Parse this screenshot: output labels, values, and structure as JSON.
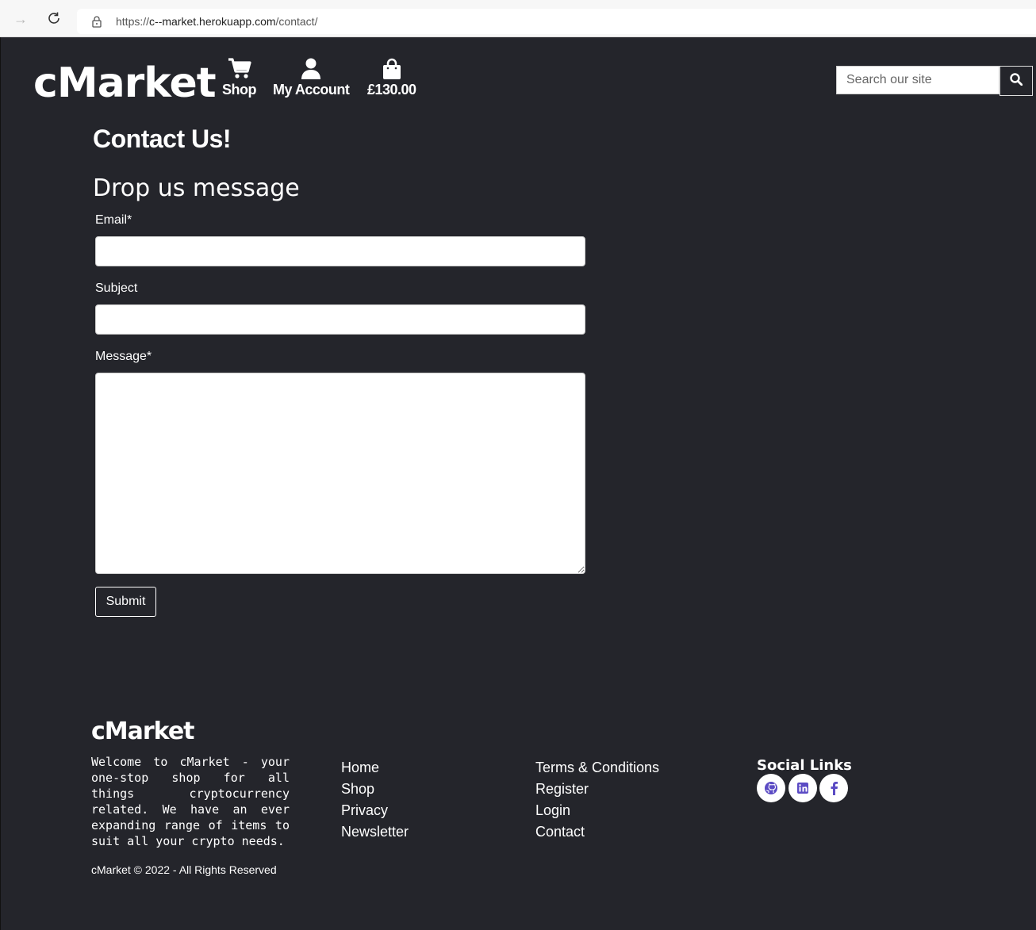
{
  "browser": {
    "url_scheme": "https://",
    "url_host": "c--market.herokuapp.com",
    "url_path": "/contact/"
  },
  "header": {
    "logo": "cMarket",
    "nav": [
      {
        "label": "Shop",
        "icon": "cart-icon"
      },
      {
        "label": "My Account",
        "icon": "user-icon"
      },
      {
        "label": "£130.00",
        "icon": "bag-icon"
      }
    ],
    "search_placeholder": "Search our site"
  },
  "main": {
    "title": "Contact Us!",
    "form_title": "Drop us message",
    "email_label": "Email*",
    "subject_label": "Subject",
    "message_label": "Message*",
    "submit_label": "Submit"
  },
  "footer": {
    "logo": "cMarket",
    "about": "Welcome to cMarket - your one-stop shop for all things cryptocurrency related. We have an ever expanding range of items to suit all your crypto needs.",
    "copyright": "cMarket © 2022 - All Rights Reserved",
    "links_col1": [
      "Home",
      "Shop",
      "Privacy",
      "Newsletter"
    ],
    "links_col2": [
      "Terms & Conditions",
      "Register",
      "Login",
      "Contact"
    ],
    "social_title": "Social Links",
    "social": [
      "github-icon",
      "linkedin-icon",
      "facebook-icon"
    ],
    "social_color": "#5b4bc4"
  }
}
